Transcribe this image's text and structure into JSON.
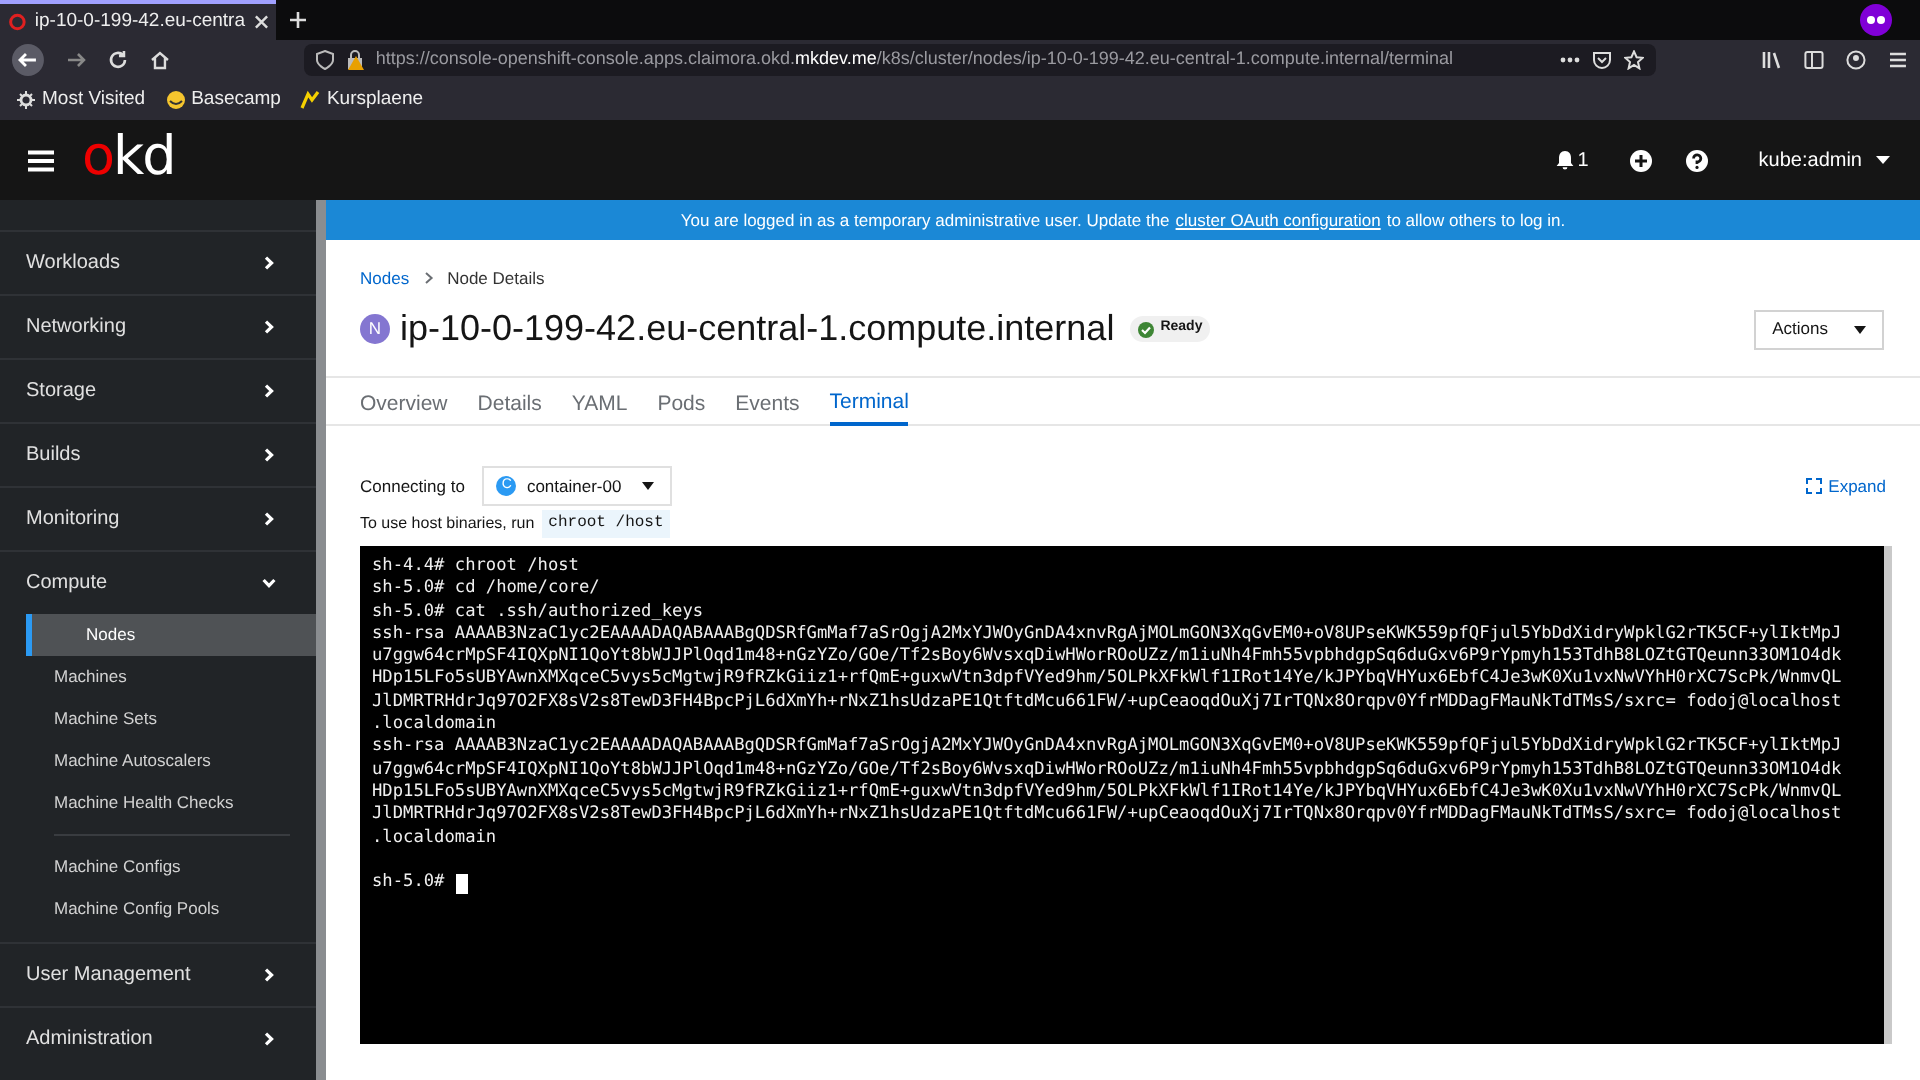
{
  "browser": {
    "tab_title": "ip-10-0-199-42.eu-centra",
    "url_prefix": "https://console-openshift-console.apps.claimora.okd.",
    "url_domain": "mkdev.me",
    "url_path": "/k8s/cluster/nodes/ip-10-0-199-42.eu-central-1.compute.internal/terminal",
    "bookmarks": [
      "Most Visited",
      "Basecamp",
      "Kursplaene"
    ]
  },
  "header": {
    "logo_parts": [
      "o",
      "kd"
    ],
    "notifications": "1",
    "user": "kube:admin"
  },
  "banner": {
    "before": "You are logged in as a temporary administrative user. Update the",
    "link": "cluster OAuth configuration",
    "after": "to allow others to log in."
  },
  "sidebar": {
    "items": [
      {
        "label": "Workloads",
        "expanded": false
      },
      {
        "label": "Networking",
        "expanded": false
      },
      {
        "label": "Storage",
        "expanded": false
      },
      {
        "label": "Builds",
        "expanded": false
      },
      {
        "label": "Monitoring",
        "expanded": false
      },
      {
        "label": "Compute",
        "expanded": true,
        "groups": [
          [
            {
              "label": "Nodes",
              "selected": true
            },
            {
              "label": "Machines",
              "selected": false
            },
            {
              "label": "Machine Sets",
              "selected": false
            },
            {
              "label": "Machine Autoscalers",
              "selected": false
            },
            {
              "label": "Machine Health Checks",
              "selected": false
            }
          ],
          [
            {
              "label": "Machine Configs",
              "selected": false
            },
            {
              "label": "Machine Config Pools",
              "selected": false
            }
          ]
        ]
      },
      {
        "label": "User Management",
        "expanded": false
      },
      {
        "label": "Administration",
        "expanded": false
      }
    ]
  },
  "breadcrumb": [
    "Nodes",
    "Node Details"
  ],
  "node": {
    "badge": "N",
    "name": "ip-10-0-199-42.eu-central-1.compute.internal",
    "status": "Ready"
  },
  "actions": "Actions",
  "tabs": [
    {
      "label": "Overview",
      "selected": false
    },
    {
      "label": "Details",
      "selected": false
    },
    {
      "label": "YAML",
      "selected": false
    },
    {
      "label": "Pods",
      "selected": false
    },
    {
      "label": "Events",
      "selected": false
    },
    {
      "label": "Terminal",
      "selected": true
    }
  ],
  "connecting": {
    "label": "Connecting to",
    "container_badge": "C",
    "container": "container-00",
    "expand": "Expand"
  },
  "hint": {
    "text": "To use host binaries, run",
    "code": "chroot /host"
  },
  "terminal": {
    "lines": [
      "sh-4.4# chroot /host",
      "sh-5.0# cd /home/core/",
      "sh-5.0# cat .ssh/authorized_keys",
      "ssh-rsa AAAAB3NzaC1yc2EAAAADAQABAAABgQDSRfGmMaf7aSrOgjA2MxYJWOyGnDA4xnvRgAjMOLmGON3XqGvEM0+oV8UPseKWK559pfQFjul5YbDdXidryWpklG2rTK5CF+ylIktMpJ",
      "u7ggw64crMpSF4IQXpNI1QoYt8bWJJPlOqd1m48+nGzYZo/GOe/Tf2sBoy6WvsxqDiwHWorROoUZz/m1iuNh4Fmh55vpbhdgpSq6duGxv6P9rYpmyh153TdhB8LOZtGTQeunn33OM1O4dk",
      "HDp15LFo5sUBYAwnXMXqceC5vys5cMgtwjR9fRZkGiiz1+rfQmE+guxwVtn3dpfVYed9hm/5OLPkXFkWlf1IRot14Ye/kJPYbqVHYux6EbfC4Je3wK0Xu1vxNwVYhH0rXC7ScPk/WnmvQL",
      "JlDMRTRHdrJq97O2FX8sV2s8TewD3FH4BpcPjL6dXmYh+rNxZ1hsUdzaPE1QtftdMcu661FW/+upCeaoqdOuXj7IrTQNx8Orqpv0YfrMDDagFMauNkTdTMsS/sxrc= fodoj@localhost",
      ".localdomain",
      "ssh-rsa AAAAB3NzaC1yc2EAAAADAQABAAABgQDSRfGmMaf7aSrOgjA2MxYJWOyGnDA4xnvRgAjMOLmGON3XqGvEM0+oV8UPseKWK559pfQFjul5YbDdXidryWpklG2rTK5CF+ylIktMpJ",
      "u7ggw64crMpSF4IQXpNI1QoYt8bWJJPlOqd1m48+nGzYZo/GOe/Tf2sBoy6WvsxqDiwHWorROoUZz/m1iuNh4Fmh55vpbhdgpSq6duGxv6P9rYpmyh153TdhB8LOZtGTQeunn33OM1O4dk",
      "HDp15LFo5sUBYAwnXMXqceC5vys5cMgtwjR9fRZkGiiz1+rfQmE+guxwVtn3dpfVYed9hm/5OLPkXFkWlf1IRot14Ye/kJPYbqVHYux6EbfC4Je3wK0Xu1vxNwVYhH0rXC7ScPk/WnmvQL",
      "JlDMRTRHdrJq97O2FX8sV2s8TewD3FH4BpcPjL6dXmYh+rNxZ1hsUdzaPE1QtftdMcu661FW/+upCeaoqdOuXj7IrTQNx8Orqpv0YfrMDDagFMauNkTdTMsS/sxrc= fodoj@localhost",
      ".localdomain"
    ],
    "prompt": "sh-5.0#"
  }
}
